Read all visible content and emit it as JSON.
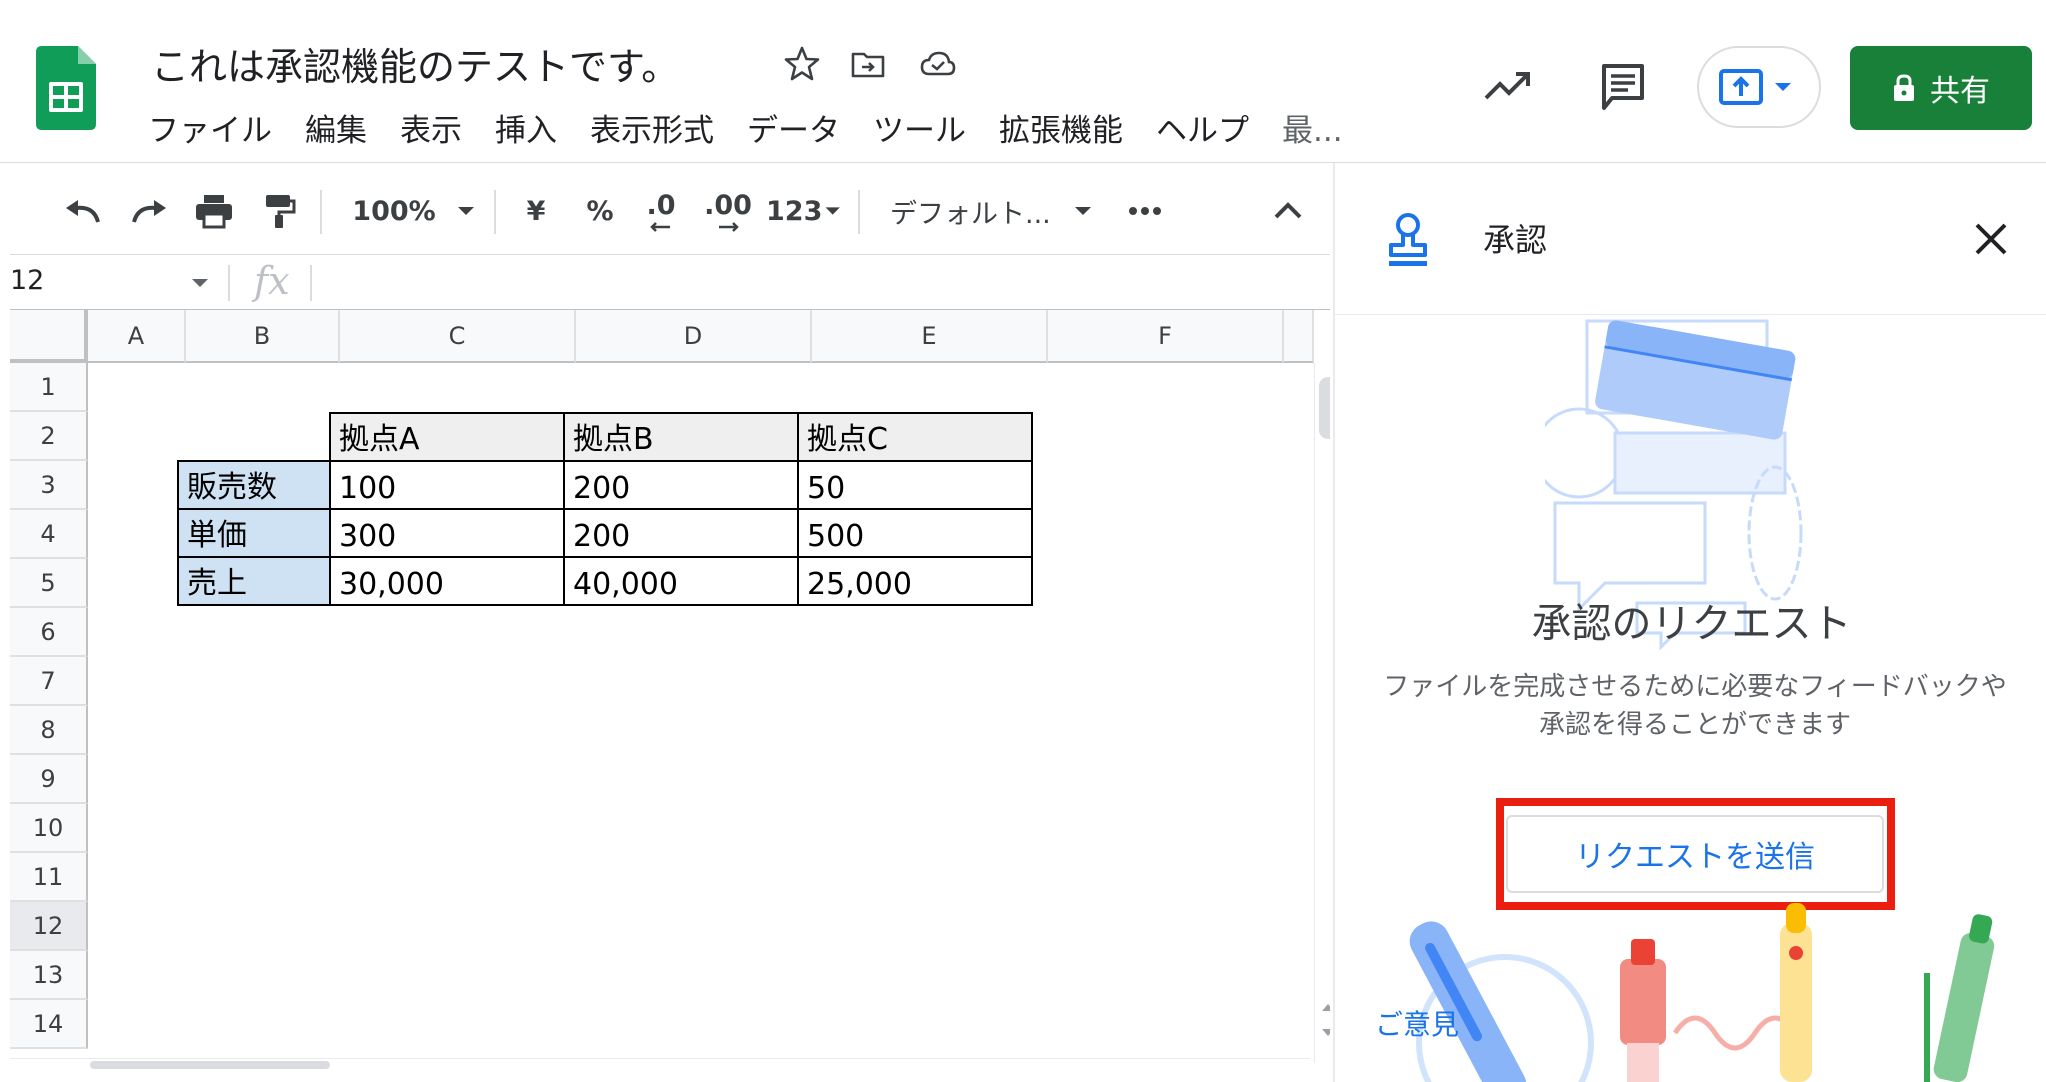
{
  "doc": {
    "title": "これは承認機能のテストです。"
  },
  "menu": [
    "ファイル",
    "編集",
    "表示",
    "挿入",
    "表示形式",
    "データ",
    "ツール",
    "拡張機能",
    "ヘルプ",
    "最..."
  ],
  "header": {
    "share_label": "共有",
    "icons": [
      "trending-up-icon",
      "comment-icon",
      "present-icon",
      "lock-icon",
      "star-icon",
      "move-folder-icon",
      "cloud-status-icon"
    ]
  },
  "toolbar": {
    "zoom": "100%",
    "currency": "¥",
    "percent": "%",
    "decrease_decimal": ".0",
    "increase_decimal": ".00",
    "number_format": "123",
    "font": "デフォルト..."
  },
  "formula_bar": {
    "namebox": "12",
    "fx": "fx"
  },
  "grid": {
    "columns": [
      "A",
      "B",
      "C",
      "D",
      "E",
      "F"
    ],
    "rows": [
      "1",
      "2",
      "3",
      "4",
      "5",
      "6",
      "7",
      "8",
      "9",
      "10",
      "11",
      "12",
      "13",
      "14"
    ],
    "selected_row": "12",
    "table": {
      "headers": [
        "拠点A",
        "拠点B",
        "拠点C"
      ],
      "rows": [
        {
          "label": "販売数",
          "values": [
            "100",
            "200",
            "50"
          ]
        },
        {
          "label": "単価",
          "values": [
            "300",
            "200",
            "500"
          ]
        },
        {
          "label": "売上",
          "values": [
            "30,000",
            "40,000",
            "25,000"
          ]
        }
      ]
    }
  },
  "panel": {
    "title": "承認",
    "heading": "承認のリクエスト",
    "description": "ファイルを完成させるために必要なフィードバックや承認を得ることができます",
    "send_button": "リクエストを送信",
    "feedback_link": "ご意見",
    "highlight_color": "#ea1f10"
  },
  "colors": {
    "share_green": "#188038",
    "accent_blue": "#1a73e8",
    "label_fill": "#cfe2f3",
    "header_fill": "#efefef"
  }
}
